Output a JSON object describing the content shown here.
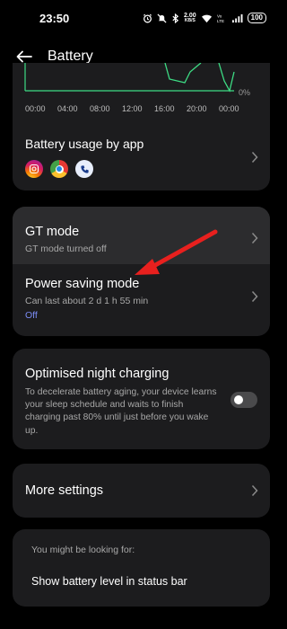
{
  "status_bar": {
    "time": "23:50",
    "net_speed_value": "2.00",
    "net_speed_unit": "KB/S",
    "battery_level": "100",
    "icons": [
      "alarm-icon",
      "mute-icon",
      "bluetooth-icon",
      "wifi-icon",
      "volte-icon",
      "signal-icon",
      "battery-icon"
    ]
  },
  "header": {
    "title": "Battery",
    "back_icon": "back-arrow-icon"
  },
  "chart": {
    "x_ticks": [
      "00:00",
      "04:00",
      "08:00",
      "12:00",
      "16:00",
      "20:00",
      "00:00"
    ],
    "y_min_label": "0%",
    "line_color": "#3ddc84"
  },
  "usage": {
    "title": "Battery usage by app",
    "apps": [
      "instagram-icon",
      "chrome-icon",
      "phone-icon"
    ]
  },
  "modes": {
    "gt_title": "GT mode",
    "gt_subtitle": "GT mode turned off",
    "power_title": "Power saving mode",
    "power_subtitle": "Can last about 2 d 1 h 55 min",
    "power_status": "Off"
  },
  "night_charging": {
    "title": "Optimised night charging",
    "description": "To decelerate battery aging, your device learns your sleep schedule and waits to finish charging past 80% until just before you wake up.",
    "enabled": false
  },
  "more_settings": {
    "label": "More settings"
  },
  "suggestions": {
    "hint": "You might be looking for:",
    "item": "Show battery level in status bar"
  },
  "annotation": {
    "arrow_color": "#e8201e"
  }
}
